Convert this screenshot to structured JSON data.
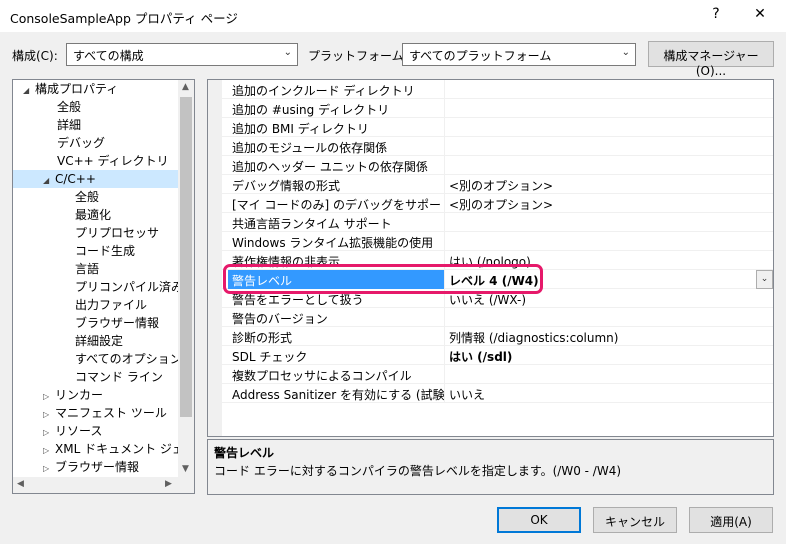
{
  "window": {
    "title": "ConsoleSampleApp プロパティ ページ",
    "help": "?",
    "close": "✕"
  },
  "toolbar": {
    "config_label": "構成(C):",
    "config_value": "すべての構成",
    "platform_label": "プラットフォーム(P):",
    "platform_value": "すべてのプラットフォーム",
    "config_manager_button": "構成マネージャー(O)..."
  },
  "tree": {
    "items": [
      {
        "label": "構成プロパティ",
        "expand": "expanded",
        "selected": false
      },
      {
        "label": "全般",
        "expand": "none",
        "selected": false
      },
      {
        "label": "詳細",
        "expand": "none",
        "selected": false
      },
      {
        "label": "デバッグ",
        "expand": "none",
        "selected": false
      },
      {
        "label": "VC++ ディレクトリ",
        "expand": "none",
        "selected": false
      },
      {
        "label": "C/C++",
        "expand": "expanded",
        "selected": true
      },
      {
        "label": "全般",
        "expand": "none",
        "selected": false
      },
      {
        "label": "最適化",
        "expand": "none",
        "selected": false
      },
      {
        "label": "プリプロセッサ",
        "expand": "none",
        "selected": false
      },
      {
        "label": "コード生成",
        "expand": "none",
        "selected": false
      },
      {
        "label": "言語",
        "expand": "none",
        "selected": false
      },
      {
        "label": "プリコンパイル済みヘッ",
        "expand": "none",
        "selected": false
      },
      {
        "label": "出力ファイル",
        "expand": "none",
        "selected": false
      },
      {
        "label": "ブラウザー情報",
        "expand": "none",
        "selected": false
      },
      {
        "label": "詳細設定",
        "expand": "none",
        "selected": false
      },
      {
        "label": "すべてのオプション",
        "expand": "none",
        "selected": false
      },
      {
        "label": "コマンド ライン",
        "expand": "none",
        "selected": false
      },
      {
        "label": "リンカー",
        "expand": "collapsed",
        "selected": false
      },
      {
        "label": "マニフェスト ツール",
        "expand": "collapsed",
        "selected": false
      },
      {
        "label": "リソース",
        "expand": "collapsed",
        "selected": false
      },
      {
        "label": "XML ドキュメント ジェネレー",
        "expand": "collapsed",
        "selected": false
      },
      {
        "label": "ブラウザー情報",
        "expand": "collapsed",
        "selected": false
      }
    ]
  },
  "grid": {
    "rows": [
      {
        "name": "追加のインクルード ディレクトリ",
        "value": ""
      },
      {
        "name": "追加の #using ディレクトリ",
        "value": ""
      },
      {
        "name": "追加の BMI ディレクトリ",
        "value": ""
      },
      {
        "name": "追加のモジュールの依存関係",
        "value": ""
      },
      {
        "name": "追加のヘッダー ユニットの依存関係",
        "value": ""
      },
      {
        "name": "デバッグ情報の形式",
        "value": "<別のオプション>"
      },
      {
        "name": "[マイ コードのみ] のデバッグをサポートする",
        "value": "<別のオプション>"
      },
      {
        "name": "共通言語ランタイム サポート",
        "value": ""
      },
      {
        "name": "Windows ランタイム拡張機能の使用",
        "value": ""
      },
      {
        "name": "著作権情報の非表示",
        "value": "はい (/nologo)"
      },
      {
        "name": "警告レベル",
        "value": "レベル 4 (/W4)"
      },
      {
        "name": "警告をエラーとして扱う",
        "value": "いいえ (/WX-)"
      },
      {
        "name": "警告のバージョン",
        "value": ""
      },
      {
        "name": "診断の形式",
        "value": "列情報 (/diagnostics:column)"
      },
      {
        "name": "SDL チェック",
        "value": "はい (/sdl)"
      },
      {
        "name": "複数プロセッサによるコンパイル",
        "value": ""
      },
      {
        "name": "Address Sanitizer を有効にする (試験段階",
        "value": "いいえ"
      }
    ],
    "selected_index": 10,
    "bold_indices": [
      10,
      14
    ]
  },
  "description": {
    "title": "警告レベル",
    "text": "コード エラーに対するコンパイラの警告レベルを指定します。(/W0 - /W4)"
  },
  "buttons": {
    "ok": "OK",
    "cancel": "キャンセル",
    "apply": "適用(A)"
  },
  "colors": {
    "selection": "#3399ff",
    "highlight_border": "#e6196a",
    "tree_selection": "#cce8ff"
  }
}
